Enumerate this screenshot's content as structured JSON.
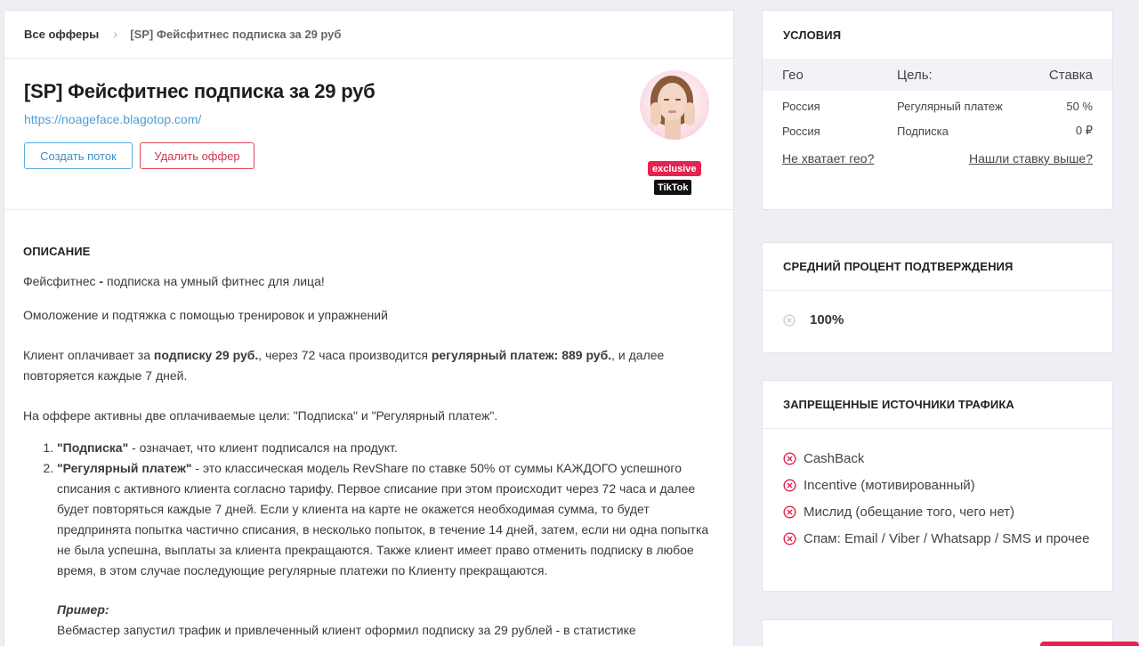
{
  "breadcrumb": {
    "root": "Все офферы",
    "current": "[SP] Фейсфитнес подписка за 29 руб"
  },
  "offer": {
    "title": "[SP] Фейсфитнес подписка за 29 руб",
    "url": "https://noageface.blagotop.com/",
    "create_button": "Создать поток",
    "delete_button": "Удалить оффер",
    "badge_exclusive": "exclusive",
    "badge_tiktok": "TikTok"
  },
  "description": {
    "heading": "ОПИСАНИЕ",
    "p1_a": "Фейсфитнес ",
    "p1_b": "-",
    "p1_c": " подписка на умный фитнес для лица!",
    "p2": "Омоложение и подтяжка с помощью тренировок и упражнений",
    "p3_a": "Клиент оплачивает за ",
    "p3_b": "подписку 29 руб.",
    "p3_c": ", через 72 часа производится ",
    "p3_d": "регулярный платеж: 889 руб.",
    "p3_e": ", и далее повторяется каждые 7 дней.",
    "p4": "На оффере активны две оплачиваемые цели: \"Подписка\" и \"Регулярный платеж\".",
    "list": [
      {
        "bold": "\"Подписка\"",
        "text": " - означает, что клиент подписался на продукт."
      },
      {
        "bold": "\"Регулярный платеж\"",
        "text": " - это классическая модель RevShare по ставке 50% от суммы КАЖДОГО успешного списания с активного клиента согласно тарифу. Первое списание при этом происходит через 72 часа и далее будет повторяться каждые 7 дней. Если у клиента на карте не окажется необходимая сумма, то будет предпринята попытка частично списания, в несколько попыток, в течение 14 дней, затем, если ни одна попытка не была успешна, выплаты за клиента прекращаются. Также клиент имеет право отменить подписку в любое время, в этом случае последующие регулярные платежи по Клиенту прекращаются."
      }
    ],
    "example_title": "Пример:",
    "example_text": "Вебмастер запустил трафик и привлеченный клиент оформил подписку за 29 рублей - в статистике"
  },
  "conditions": {
    "title": "УСЛОВИЯ",
    "headers": {
      "geo": "Гео",
      "goal": "Цель:",
      "rate": "Ставка"
    },
    "rows": [
      {
        "geo": "Россия",
        "goal": "Регулярный платеж",
        "rate": "50 %"
      },
      {
        "geo": "Россия",
        "goal": "Подписка",
        "rate": "0 ₽"
      }
    ],
    "link_missing_geo": "Не хватает гео?",
    "link_higher_rate": "Нашли ставку выше?"
  },
  "confirmation": {
    "title": "СРЕДНИЙ ПРОЦЕНТ ПОДТВЕРЖДЕНИЯ",
    "value": "100%"
  },
  "forbidden": {
    "title": "ЗАПРЕЩЕННЫЕ ИСТОЧНИКИ ТРАФИКА",
    "items": [
      "CashBack",
      "Incentive (мотивированный)",
      "Мислид (обещание того, чего нет)",
      "Спам: Email / Viber / Whatsapp / SMS и прочее"
    ]
  },
  "colors": {
    "accent_link": "#4a9fd8",
    "danger": "#e5234f",
    "background": "#f0eef5"
  }
}
